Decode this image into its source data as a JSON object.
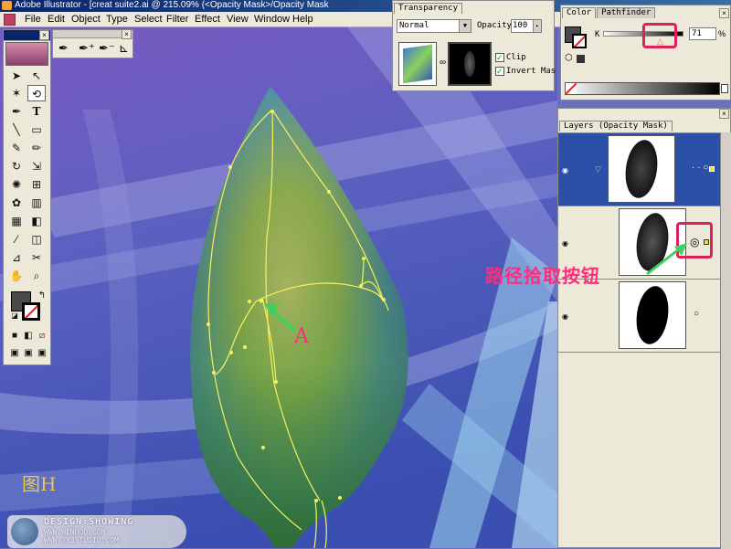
{
  "window": {
    "title": "Adobe Illustrator - [creat suite2.ai @ 215.09% (<Opacity Mask>/Opacity Mask"
  },
  "menu": [
    "File",
    "Edit",
    "Object",
    "Type",
    "Select",
    "Filter",
    "Effect",
    "View",
    "Window",
    "Help"
  ],
  "transparency": {
    "tab": "Transparency",
    "blend_mode": "Normal",
    "opacity_label": "Opacity:",
    "opacity_value": "100",
    "clip_label": "Clip",
    "invert_label": "Invert Mas"
  },
  "color_panel": {
    "tabs": [
      "Color",
      "Pathfinder"
    ],
    "channel_label": "K",
    "k_value": "71",
    "percent": "%"
  },
  "layers_panel": {
    "tab": "Layers (Opacity Mask)"
  },
  "annotations": {
    "a_label": "A",
    "cn_label": "路径拾取按钮",
    "figure_label": "图H"
  },
  "watermark": {
    "line1": "DESIGN:SHOWING",
    "line2": "WWW.WENHOO.COM",
    "line3": "WWW.3X3STUDIO.COM"
  },
  "colors": {
    "annotation_red": "#e0205a",
    "arrow_green": "#40d060",
    "path_yellow": "#f6f060",
    "selected_row": "#2c4fa8"
  }
}
